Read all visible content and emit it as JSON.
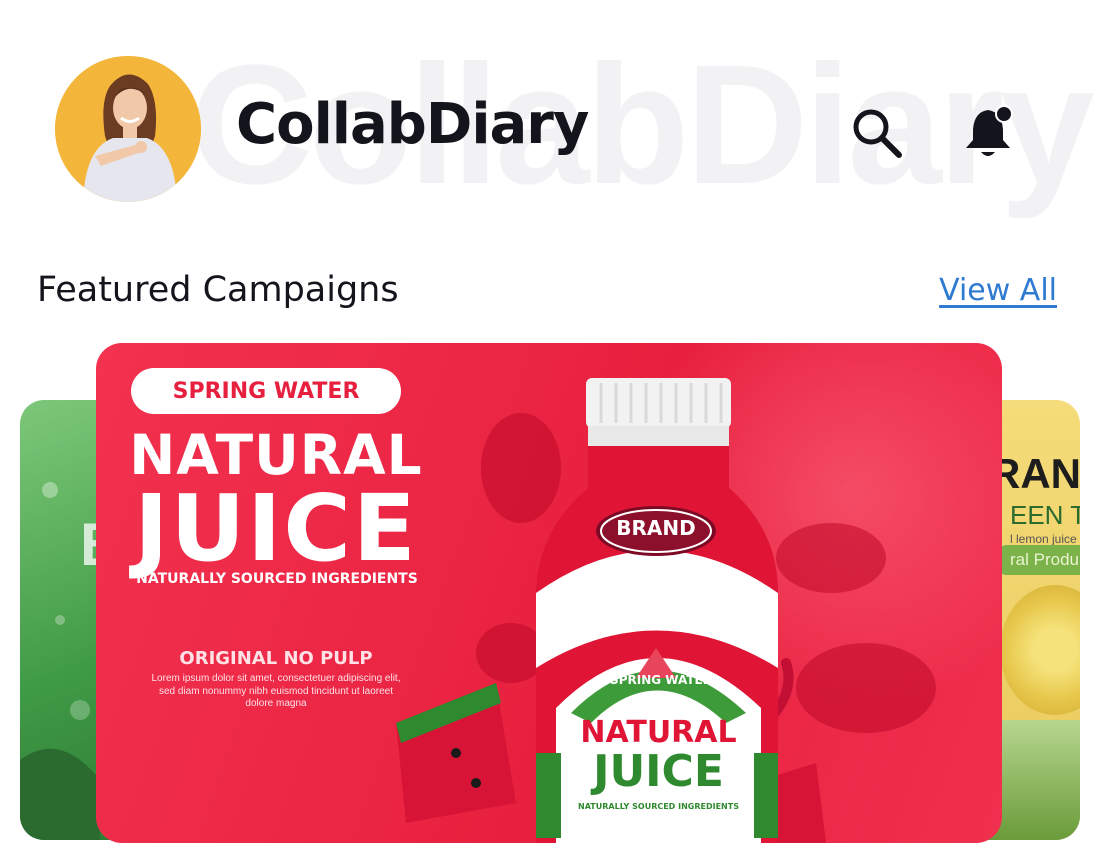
{
  "app": {
    "name": "CollabDiary",
    "watermark": "CollabDiary"
  },
  "header": {
    "avatar_icon": "user-avatar",
    "search_icon": "search-icon",
    "notification_icon": "bell-icon"
  },
  "section": {
    "title": "Featured Campaigns",
    "view_all": "View All"
  },
  "carousel": {
    "main": {
      "pill": "SPRING WATER",
      "headline_1": "NATURAL",
      "headline_2": "JUICE",
      "tagline": "NATURALLY SOURCED INGREDIENTS",
      "sub": "ORIGINAL NO PULP",
      "lorem": "Lorem ipsum dolor sit amet, consectetuer adipiscing elit, sed diam nonummy nibh euismod tincidunt ut laoreet dolore magna",
      "bottle_brand": "BRAND",
      "bottle_arc": "SPRING WATER",
      "bottle_label_1": "NATURAL",
      "bottle_label_2": "JUICE",
      "bottle_tagline": "NATURALLY SOURCED INGREDIENTS"
    },
    "left_peek": {
      "text": "B"
    },
    "right_peek": {
      "line1": "RANI",
      "line2": "EEN TE",
      "line3": "l lemon juice",
      "badge": "ral Produ"
    }
  },
  "colors": {
    "accent": "#2f7ad1",
    "card_red": "#e8203f",
    "dark_text": "#14141c",
    "avatar_bg": "#f4b63a"
  }
}
